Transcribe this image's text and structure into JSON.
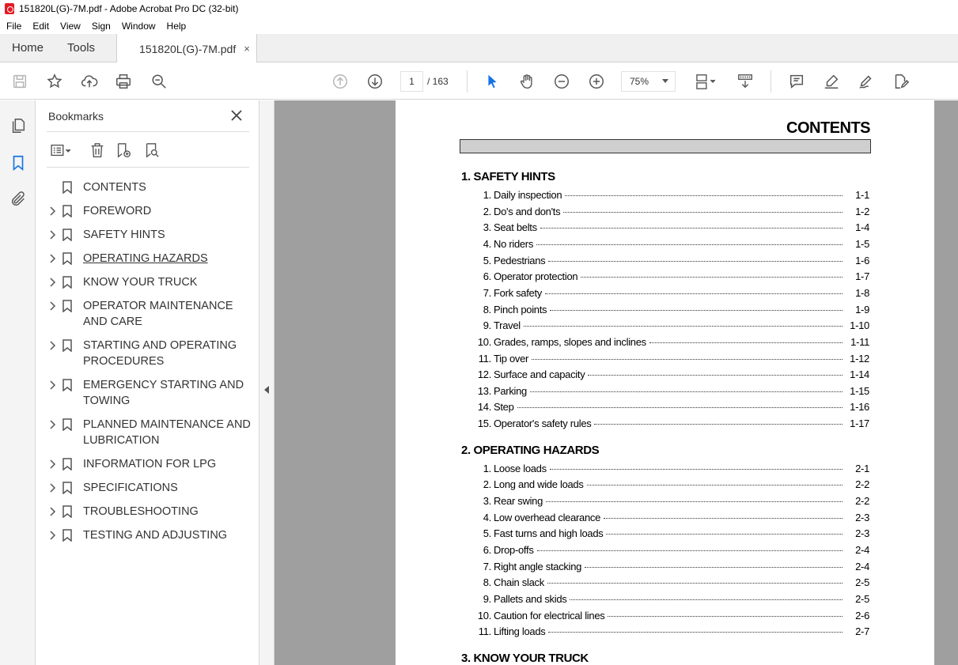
{
  "window": {
    "title": "151820L(G)-7M.pdf - Adobe Acrobat Pro DC (32-bit)"
  },
  "menu": [
    "File",
    "Edit",
    "View",
    "Sign",
    "Window",
    "Help"
  ],
  "tabs": {
    "home": "Home",
    "tools": "Tools",
    "document": "151820L(G)-7M.pdf",
    "close": "×"
  },
  "toolbar": {
    "page_current": "1",
    "page_total": "/ 163",
    "zoom": "75%"
  },
  "bookmarks": {
    "title": "Bookmarks",
    "items": [
      {
        "label": "CONTENTS",
        "expandable": false
      },
      {
        "label": "FOREWORD",
        "expandable": true
      },
      {
        "label": "SAFETY HINTS",
        "expandable": true
      },
      {
        "label": "OPERATING HAZARDS",
        "expandable": true,
        "underlined": true
      },
      {
        "label": "KNOW YOUR TRUCK",
        "expandable": true
      },
      {
        "label": "OPERATOR MAINTENANCE AND CARE",
        "expandable": true
      },
      {
        "label": "STARTING AND OPERATING PROCEDURES",
        "expandable": true
      },
      {
        "label": "EMERGENCY STARTING AND TOWING",
        "expandable": true
      },
      {
        "label": "PLANNED MAINTENANCE AND LUBRICATION",
        "expandable": true
      },
      {
        "label": "INFORMATION FOR LPG",
        "expandable": true
      },
      {
        "label": "SPECIFICATIONS",
        "expandable": true
      },
      {
        "label": "TROUBLESHOOTING",
        "expandable": true
      },
      {
        "label": "TESTING AND ADJUSTING",
        "expandable": true
      }
    ]
  },
  "document": {
    "heading": "CONTENTS",
    "sections": [
      {
        "title": "1. SAFETY HINTS",
        "entries": [
          {
            "num": "1.",
            "text": "Daily inspection",
            "page": "1-1"
          },
          {
            "num": "2.",
            "text": "Do's and don'ts",
            "page": "1-2"
          },
          {
            "num": "3.",
            "text": "Seat belts",
            "page": "1-4"
          },
          {
            "num": "4.",
            "text": "No riders",
            "page": "1-5"
          },
          {
            "num": "5.",
            "text": "Pedestrians",
            "page": "1-6"
          },
          {
            "num": "6.",
            "text": "Operator protection",
            "page": "1-7"
          },
          {
            "num": "7.",
            "text": "Fork safety",
            "page": "1-8"
          },
          {
            "num": "8.",
            "text": "Pinch points",
            "page": "1-9"
          },
          {
            "num": "9.",
            "text": "Travel",
            "page": "1-10"
          },
          {
            "num": "10.",
            "text": "Grades, ramps, slopes and inclines",
            "page": "1-11"
          },
          {
            "num": "11.",
            "text": "Tip over",
            "page": "1-12"
          },
          {
            "num": "12.",
            "text": "Surface and capacity",
            "page": "1-14"
          },
          {
            "num": "13.",
            "text": "Parking",
            "page": "1-15"
          },
          {
            "num": "14.",
            "text": "Step",
            "page": "1-16"
          },
          {
            "num": "15.",
            "text": "Operator's safety rules",
            "page": "1-17"
          }
        ]
      },
      {
        "title": "2. OPERATING HAZARDS",
        "entries": [
          {
            "num": "1.",
            "text": "Loose loads",
            "page": "2-1"
          },
          {
            "num": "2.",
            "text": "Long and wide loads",
            "page": "2-2"
          },
          {
            "num": "3.",
            "text": "Rear swing",
            "page": "2-2"
          },
          {
            "num": "4.",
            "text": "Low overhead clearance",
            "page": "2-3"
          },
          {
            "num": "5.",
            "text": "Fast turns and high loads",
            "page": "2-3"
          },
          {
            "num": "6.",
            "text": "Drop-offs",
            "page": "2-4"
          },
          {
            "num": "7.",
            "text": "Right angle stacking",
            "page": "2-4"
          },
          {
            "num": "8.",
            "text": "Chain slack",
            "page": "2-5"
          },
          {
            "num": "9.",
            "text": "Pallets and skids",
            "page": "2-5"
          },
          {
            "num": "10.",
            "text": "Caution for electrical lines",
            "page": "2-6"
          },
          {
            "num": "11.",
            "text": "Lifting loads",
            "page": "2-7"
          }
        ]
      },
      {
        "title": "3. KNOW YOUR TRUCK",
        "entries": []
      }
    ]
  }
}
